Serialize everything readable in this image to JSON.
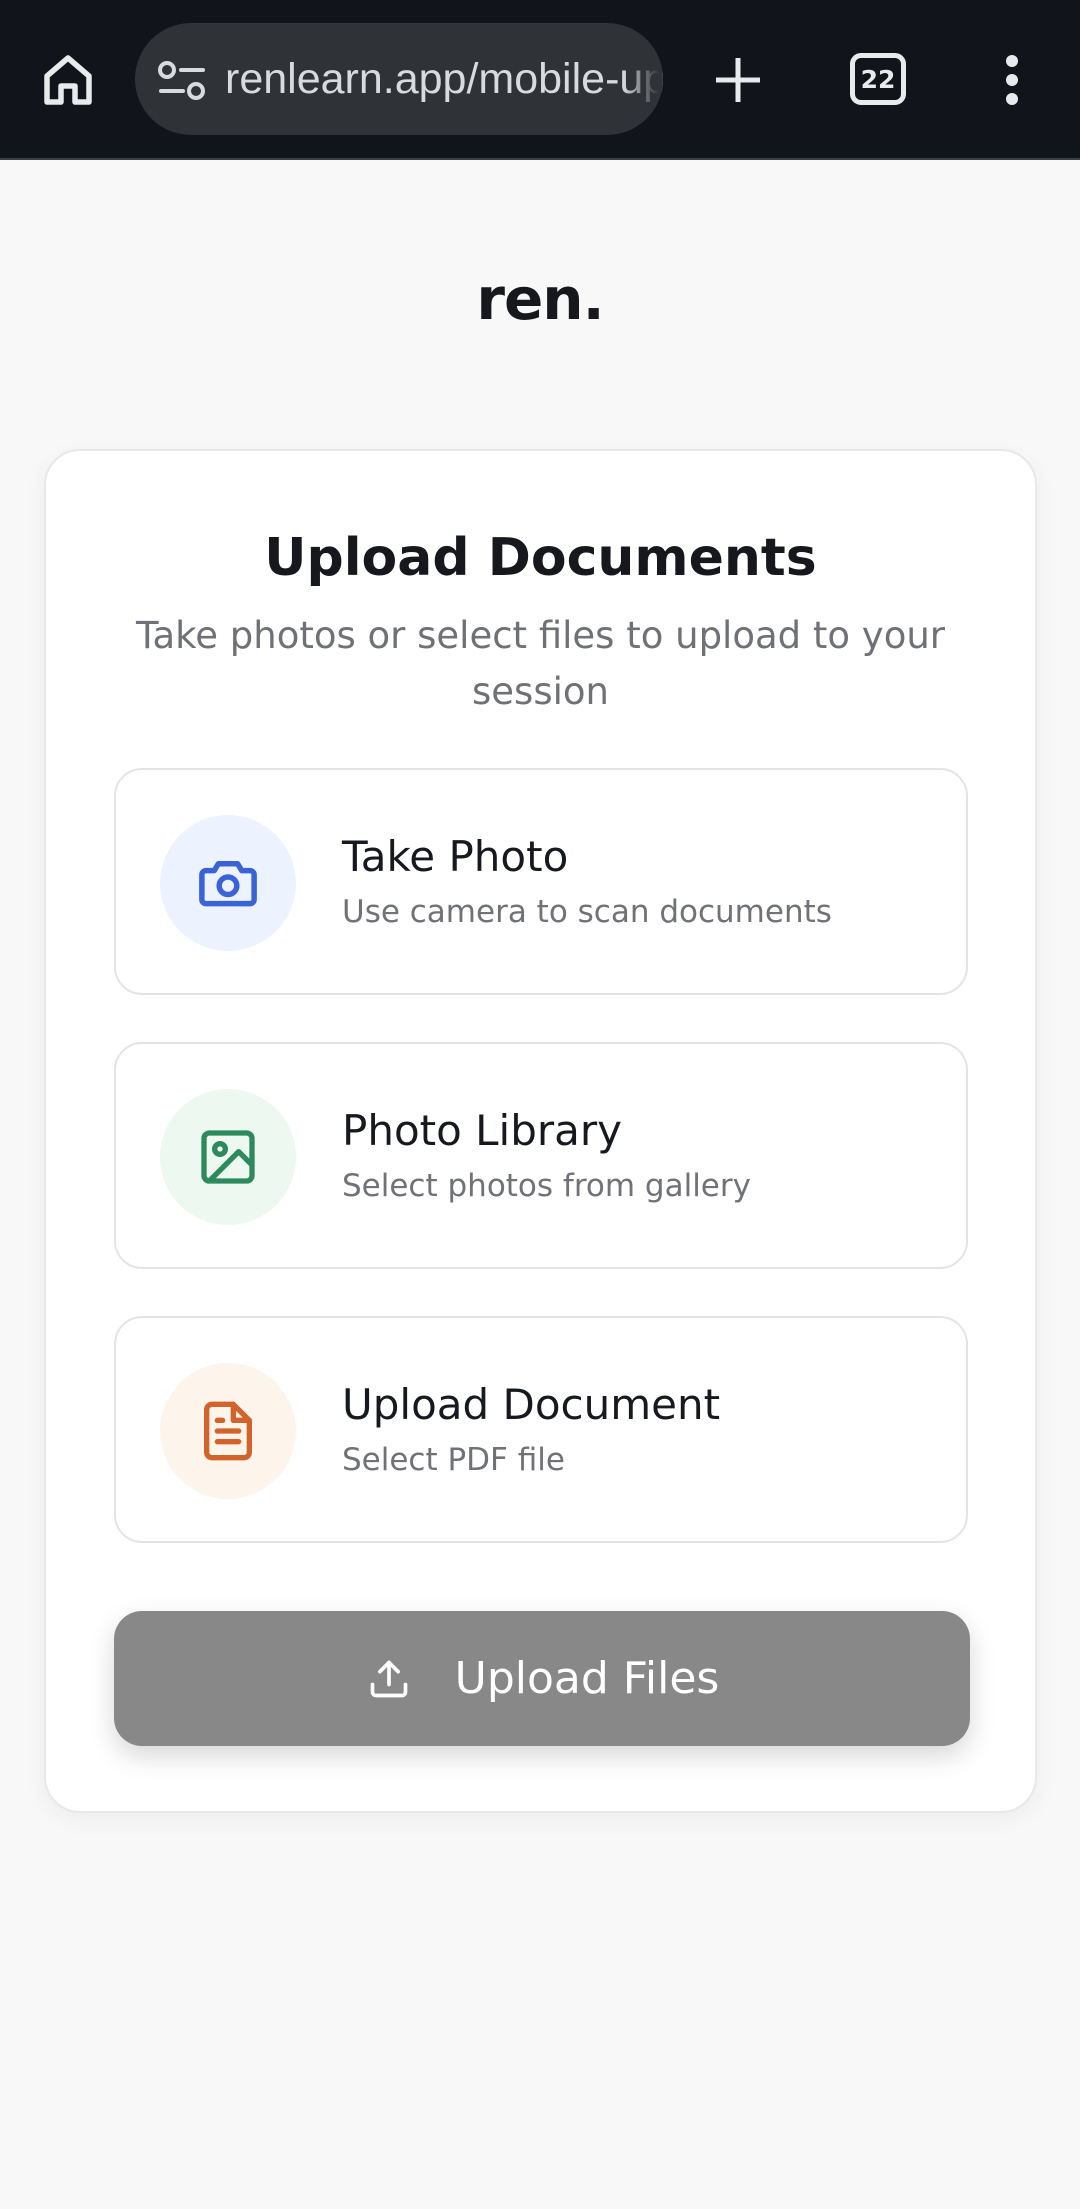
{
  "browser": {
    "url": "renlearn.app/mobile-upload",
    "tab_count": "22"
  },
  "page": {
    "brand": "ren.",
    "title": "Upload Documents",
    "subtitle": "Take photos or select files to upload to your session",
    "options": [
      {
        "title": "Take Photo",
        "description": "Use camera to scan documents",
        "icon": "camera-icon",
        "accent": "#3b63d8",
        "tint": "#edf3fe"
      },
      {
        "title": "Photo Library",
        "description": "Select photos from gallery",
        "icon": "image-icon",
        "accent": "#2e8a5c",
        "tint": "#edf8f1"
      },
      {
        "title": "Upload Document",
        "description": "Select PDF file",
        "icon": "document-icon",
        "accent": "#d2632b",
        "tint": "#fdf4ec"
      }
    ],
    "upload_button": {
      "label": "Upload Files",
      "icon": "upload-icon",
      "color": "#888888"
    }
  }
}
